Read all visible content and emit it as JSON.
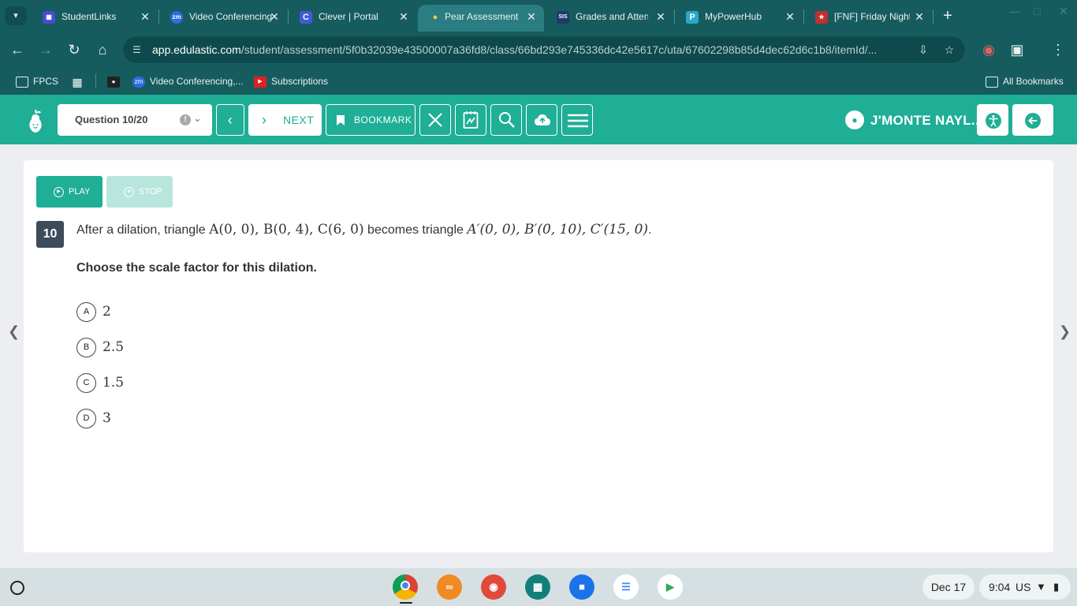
{
  "browser": {
    "tabs": [
      {
        "title": "StudentLinks",
        "favicon": "sl",
        "color": "#4a4ad0"
      },
      {
        "title": "Video Conferencing",
        "favicon": "zm",
        "color": "#2d6cdf"
      },
      {
        "title": "Clever | Portal",
        "favicon": "C",
        "color": "#3f5bd6"
      },
      {
        "title": "Pear Assessment",
        "favicon": "pear",
        "color": "#2a7d80"
      },
      {
        "title": "Grades and Attendance",
        "favicon": "SIS",
        "color": "#1e3a6b"
      },
      {
        "title": "MyPowerHub",
        "favicon": "P",
        "color": "#2aa7c9"
      },
      {
        "title": "[FNF] Friday Night Funkin",
        "favicon": "fnf",
        "color": "#c03030"
      }
    ],
    "url_host": "app.edulastic.com",
    "url_path": "/student/assessment/5f0b32039e43500007a36fd8/class/66bd293e745336dc42e5617c/uta/67602298b85d4dec62d6c1b8/itemId/...",
    "bookmarks": {
      "fpcs": "FPCS",
      "video_conf": "Video Conferencing,...",
      "subscriptions": "Subscriptions",
      "all_bookmarks": "All Bookmarks"
    }
  },
  "toolbar": {
    "question_select": "Question 10/20",
    "next_label": "NEXT",
    "bookmark_label": "BOOKMARK",
    "user_name": "J'MONTE NAYL..."
  },
  "question": {
    "number": "10",
    "play_label": "PLAY",
    "stop_label": "STOP",
    "stem_before": "After a dilation, triangle ",
    "math_original": "A(0, 0), B(0, 4), C(6, 0)",
    "stem_middle": " becomes triangle ",
    "math_image": "A′(0, 0), B′(0, 10), C′(15, 0)",
    "stem_end": ".",
    "prompt": "Choose the scale factor for this dilation.",
    "options": [
      {
        "letter": "A",
        "value": "2"
      },
      {
        "letter": "B",
        "value": "2.5"
      },
      {
        "letter": "C",
        "value": "1.5"
      },
      {
        "letter": "D",
        "value": "3"
      }
    ]
  },
  "shelf": {
    "date": "Dec 17",
    "time": "9:04",
    "locale": "US"
  },
  "colors": {
    "brand": "#1fae96",
    "browser_frame": "#165c5f"
  }
}
